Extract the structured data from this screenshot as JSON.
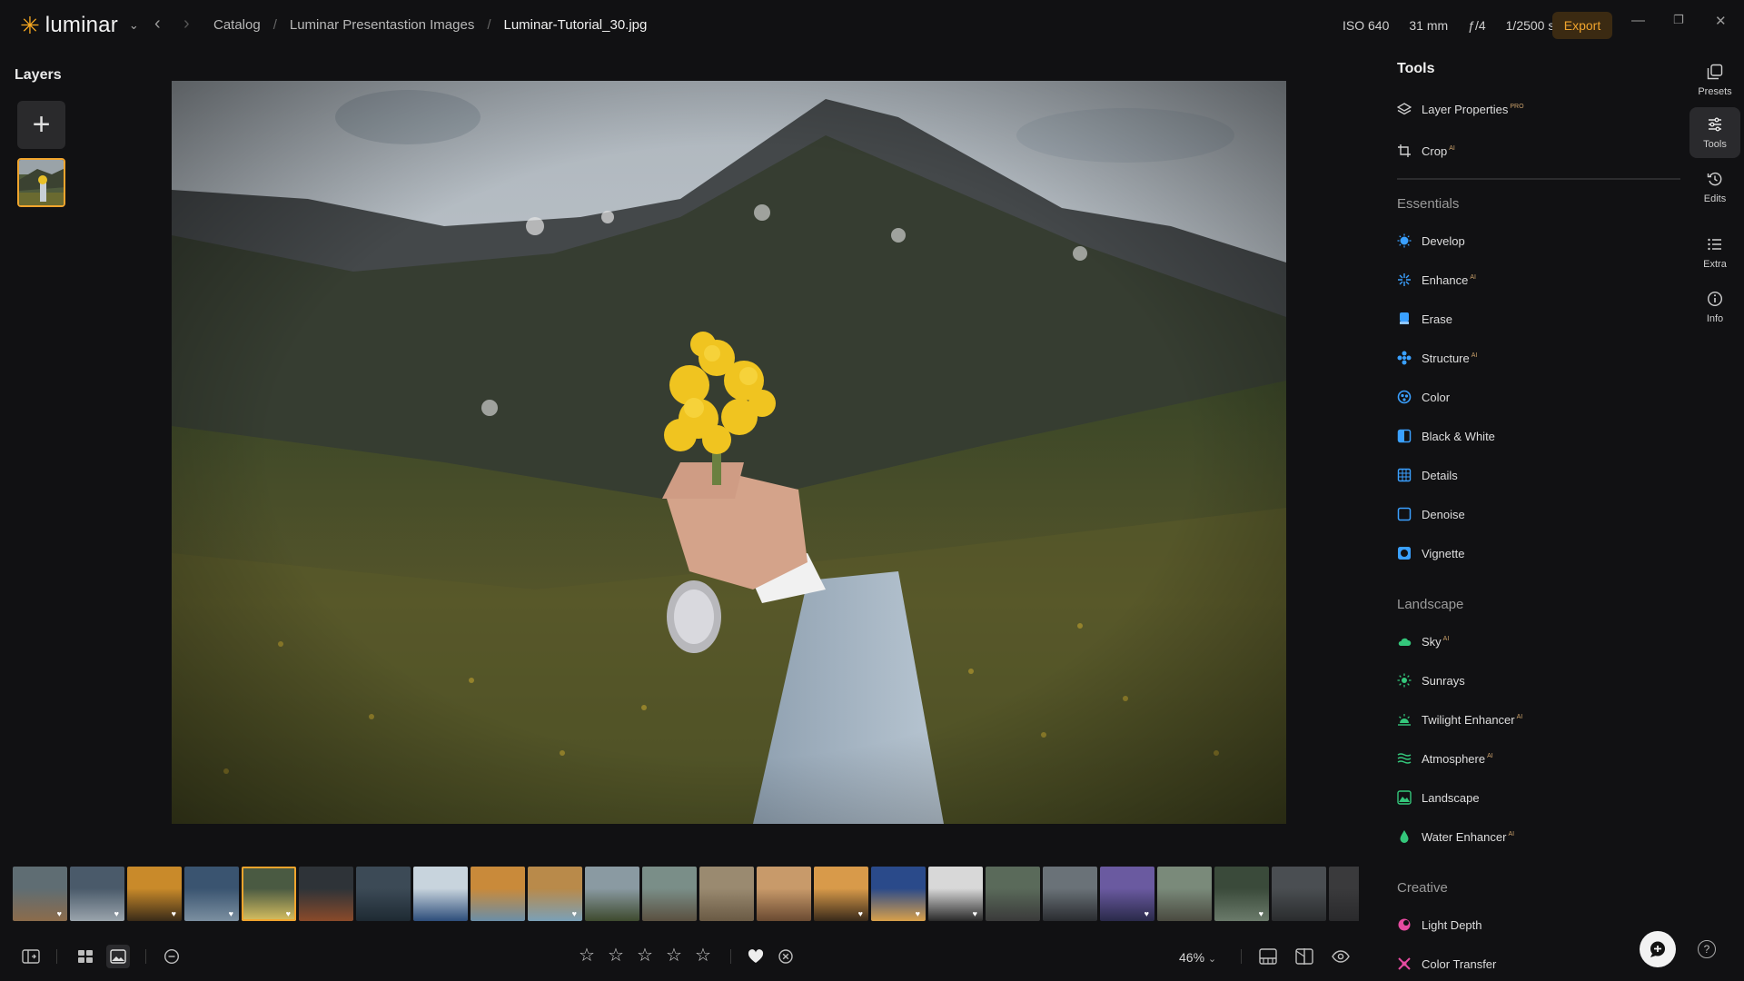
{
  "app": {
    "name": "luminar"
  },
  "breadcrumb": {
    "root": "Catalog",
    "album": "Luminar Presentastion Images",
    "file": "Luminar-Tutorial_30.jpg"
  },
  "meta": {
    "iso": "ISO 640",
    "focal": "31 mm",
    "aperture": "ƒ/4",
    "shutter": "1/2500 s"
  },
  "toolbar": {
    "export_label": "Export"
  },
  "layers": {
    "title": "Layers"
  },
  "tools": {
    "title": "Tools",
    "top": [
      {
        "label": "Layer Properties",
        "badge": "PRO",
        "icon": "layers-icon"
      },
      {
        "label": "Crop",
        "badge": "AI",
        "icon": "crop-icon"
      }
    ],
    "essentials": {
      "title": "Essentials",
      "items": [
        {
          "label": "Develop",
          "badge": "",
          "icon": "develop-icon"
        },
        {
          "label": "Enhance",
          "badge": "AI",
          "icon": "enhance-icon"
        },
        {
          "label": "Erase",
          "badge": "",
          "icon": "erase-icon"
        },
        {
          "label": "Structure",
          "badge": "AI",
          "icon": "structure-icon"
        },
        {
          "label": "Color",
          "badge": "",
          "icon": "color-icon"
        },
        {
          "label": "Black & White",
          "badge": "",
          "icon": "black-white-icon"
        },
        {
          "label": "Details",
          "badge": "",
          "icon": "details-icon"
        },
        {
          "label": "Denoise",
          "badge": "",
          "icon": "denoise-icon"
        },
        {
          "label": "Vignette",
          "badge": "",
          "icon": "vignette-icon"
        }
      ]
    },
    "landscape": {
      "title": "Landscape",
      "items": [
        {
          "label": "Sky",
          "badge": "AI",
          "icon": "sky-icon"
        },
        {
          "label": "Sunrays",
          "badge": "",
          "icon": "sunrays-icon"
        },
        {
          "label": "Twilight Enhancer",
          "badge": "AI",
          "icon": "twilight-icon"
        },
        {
          "label": "Atmosphere",
          "badge": "AI",
          "icon": "atmosphere-icon"
        },
        {
          "label": "Landscape",
          "badge": "",
          "icon": "landscape-icon"
        },
        {
          "label": "Water Enhancer",
          "badge": "AI",
          "icon": "water-icon"
        }
      ]
    },
    "creative": {
      "title": "Creative",
      "items": [
        {
          "label": "Light Depth",
          "badge": "",
          "icon": "light-depth-icon"
        },
        {
          "label": "Color Transfer",
          "badge": "",
          "icon": "color-transfer-icon"
        }
      ]
    }
  },
  "rail": [
    {
      "label": "Presets",
      "icon": "presets-icon",
      "active": false
    },
    {
      "label": "Tools",
      "icon": "tools-icon",
      "active": true
    },
    {
      "label": "Edits",
      "icon": "edits-icon",
      "active": false
    },
    {
      "label": "Extra",
      "icon": "extra-icon",
      "active": false
    },
    {
      "label": "Info",
      "icon": "info-icon",
      "active": false
    }
  ],
  "filmstrip": {
    "count": 24,
    "selected_index": 4,
    "favorited": [
      0,
      1,
      2,
      3,
      4,
      9,
      14,
      15,
      16,
      19,
      21
    ],
    "palettes": [
      [
        "#5f6d73",
        "#8c6c4b"
      ],
      [
        "#4a5a6a",
        "#9aa4ac"
      ],
      [
        "#c98a2a",
        "#3a2b18"
      ],
      [
        "#3a5470",
        "#7b8fa0"
      ],
      [
        "#4a5a42",
        "#d8c060"
      ],
      [
        "#2e3338",
        "#8a4a2a"
      ],
      [
        "#3c4a56",
        "#1e2a33"
      ],
      [
        "#c8d4dd",
        "#2d4d7a"
      ],
      [
        "#c98a3a",
        "#6a8ea8"
      ],
      [
        "#b98a4a",
        "#7aa0b8"
      ],
      [
        "#8a9aa2",
        "#3e4a2e"
      ],
      [
        "#7a8e88",
        "#5a5040"
      ],
      [
        "#9a8a70",
        "#6a5a44"
      ],
      [
        "#c89a6a",
        "#6a4a32"
      ],
      [
        "#d89a4a",
        "#3a2a1a"
      ],
      [
        "#2a4a8a",
        "#d8a04a"
      ],
      [
        "#d8d8d8",
        "#2a2a2a"
      ],
      [
        "#5a6a5a",
        "#3a3a3a"
      ],
      [
        "#6a7278",
        "#2a2c30"
      ],
      [
        "#6a5aa0",
        "#2a2a4a"
      ],
      [
        "#7a8a7a",
        "#4a4a40"
      ],
      [
        "#3a4a3a",
        "#6a7a6a"
      ],
      [
        "#4a4e52",
        "#2a2c2e"
      ],
      [
        "#3a3a3c",
        "#2a2a2c"
      ]
    ]
  },
  "bottombar": {
    "rating": 0,
    "zoom": "46%"
  }
}
